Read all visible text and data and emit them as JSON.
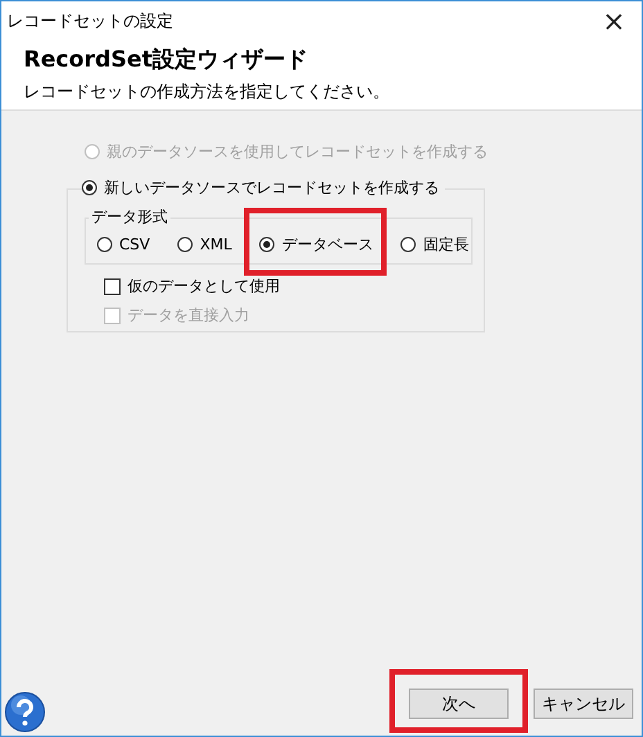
{
  "window": {
    "title": "レコードセットの設定",
    "close": "×"
  },
  "header": {
    "title": "RecordSet設定ウィザード",
    "subtitle": "レコードセットの作成方法を指定してください。"
  },
  "source_options": [
    {
      "label": "親のデータソースを使用してレコードセットを作成する",
      "selected": false,
      "disabled": true
    },
    {
      "label": "新しいデータソースでレコードセットを作成する",
      "selected": true,
      "disabled": false
    }
  ],
  "data_format": {
    "legend": "データ形式",
    "options": [
      {
        "label": "CSV",
        "selected": false,
        "highlighted": false
      },
      {
        "label": "XML",
        "selected": false,
        "highlighted": false
      },
      {
        "label": "データベース",
        "selected": true,
        "highlighted": true
      },
      {
        "label": "固定長",
        "selected": false,
        "highlighted": false
      }
    ]
  },
  "checkboxes": [
    {
      "label": "仮のデータとして使用",
      "checked": false,
      "disabled": false
    },
    {
      "label": "データを直接入力",
      "checked": false,
      "disabled": true
    }
  ],
  "buttons": [
    {
      "label": "次へ",
      "highlighted": true
    },
    {
      "label": "キャンセル",
      "highlighted": false
    }
  ]
}
